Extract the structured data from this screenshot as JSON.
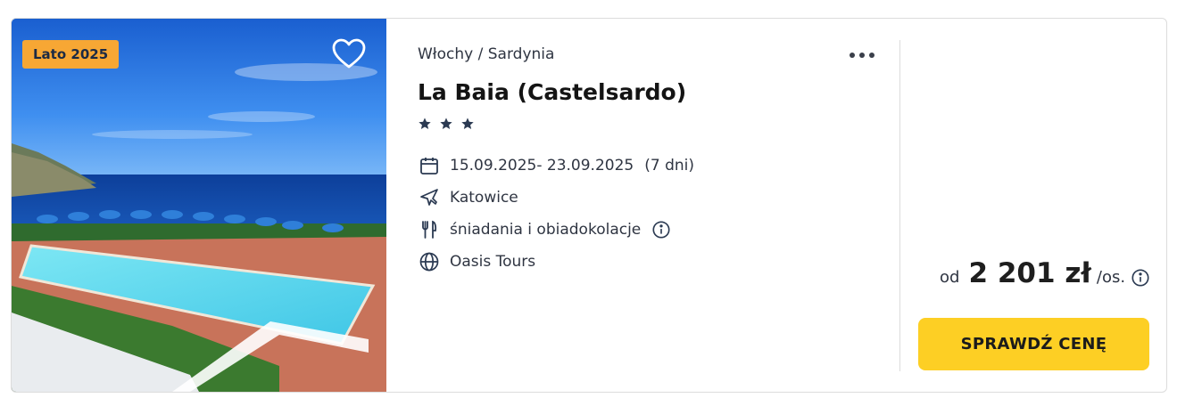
{
  "offer": {
    "badge": "Lato 2025",
    "region": "Włochy / Sardynia",
    "hotel_name": "La Baia (Castelsardo)",
    "stars": 3,
    "dates": "15.09.2025- 23.09.2025",
    "duration": "(7 dni)",
    "departure": "Katowice",
    "board": "śniadania i obiadokolacje",
    "operator": "Oasis Tours",
    "price_prefix": "od",
    "price_value": "2 201 zł",
    "price_suffix": "/os.",
    "cta_label": "SPRAWDŹ CENĘ"
  },
  "icons": {
    "favorite": "heart-icon",
    "more": "more-dots-icon",
    "star": "star-icon",
    "calendar": "calendar-icon",
    "plane": "plane-icon",
    "cutlery": "cutlery-icon",
    "info": "info-icon",
    "globe": "globe-icon"
  },
  "colors": {
    "badge_bg": "#f7a734",
    "cta_bg": "#fdcf24",
    "text": "#2f3542",
    "border": "#dcdcdc"
  }
}
